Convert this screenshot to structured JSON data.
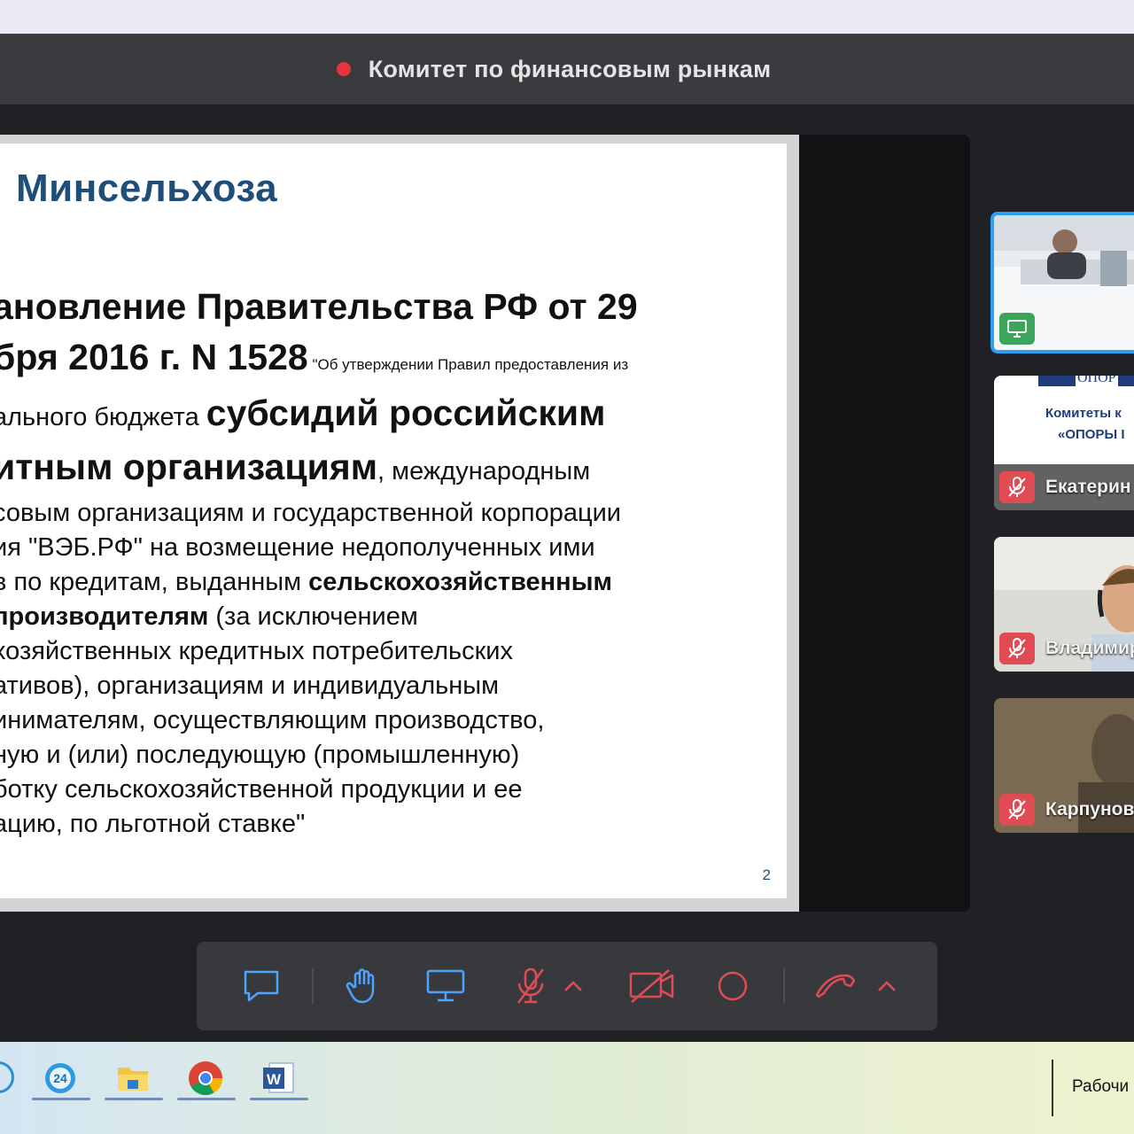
{
  "meeting": {
    "title": "Комитет по финансовым рынкам",
    "rec_color": "#e8323c"
  },
  "slide": {
    "heading": "Минсельхоза",
    "lines": [
      {
        "parts": [
          {
            "t": "ановление Правительства РФ от 29",
            "s": "big"
          }
        ]
      },
      {
        "parts": [
          {
            "t": "бря 2016 г. N 1528",
            "s": "big"
          },
          {
            "t": " \"Об утверждении Правил предоставления из",
            "s": "small"
          }
        ]
      },
      {
        "parts": [
          {
            "t": "ального бюджета ",
            "s": "norm"
          },
          {
            "t": "субсидий российским",
            "s": "mid"
          }
        ]
      },
      {
        "parts": [
          {
            "t": "итным организациям",
            "s": "mid"
          },
          {
            "t": ", международным",
            "s": "norm"
          }
        ]
      },
      {
        "parts": [
          {
            "t": "совым организациям и государственной корпорации",
            "s": "norm"
          }
        ]
      },
      {
        "parts": [
          {
            "t": "ия \"ВЭБ.РФ\" на возмещение недополученных ими",
            "s": "norm"
          }
        ]
      },
      {
        "parts": [
          {
            "t": "в по кредитам, выданным ",
            "s": "norm"
          },
          {
            "t": "сельскохозяйственным",
            "s": "bold"
          }
        ]
      },
      {
        "parts": [
          {
            "t": "производителям",
            "s": "bold"
          },
          {
            "t": " (за исключением",
            "s": "norm"
          }
        ]
      },
      {
        "parts": [
          {
            "t": "хозяйственных кредитных потребительских",
            "s": "norm"
          }
        ]
      },
      {
        "parts": [
          {
            "t": "ативов), организациям и индивидуальным",
            "s": "norm"
          }
        ]
      },
      {
        "parts": [
          {
            "t": "инимателям, осуществляющим производство,",
            "s": "norm"
          }
        ]
      },
      {
        "parts": [
          {
            "t": "ную и (или) последующую (промышленную)",
            "s": "norm"
          }
        ]
      },
      {
        "parts": [
          {
            "t": "ботку сельскохозяйственной продукции и ее",
            "s": "norm"
          }
        ]
      },
      {
        "parts": [
          {
            "t": "ацию, по льготной ставке\"",
            "s": "norm"
          }
        ]
      }
    ],
    "page_number": "2"
  },
  "participants": [
    {
      "name": "",
      "badge": "screen-share-icon",
      "active": true
    },
    {
      "name": "Екатерин",
      "badge": "mic-off-icon",
      "thumb_text": [
        "Комитеты к",
        "«ОПОРЫ I"
      ],
      "logo": "ОПОР"
    },
    {
      "name": "Владимир",
      "badge": "mic-off-icon"
    },
    {
      "name": "Карпунов",
      "badge": "mic-off-icon"
    }
  ],
  "toolbar": {
    "buttons": [
      "chat-icon",
      "raise-hand-icon",
      "screen-share-icon",
      "mic-off-icon",
      "mic-options-icon",
      "camera-off-icon",
      "record-icon",
      "leave-call-icon",
      "leave-options-icon"
    ]
  },
  "taskbar": {
    "apps": [
      "24-app-icon",
      "file-explorer-icon",
      "chrome-icon",
      "word-icon"
    ],
    "desktop_label": "Рабочи"
  }
}
